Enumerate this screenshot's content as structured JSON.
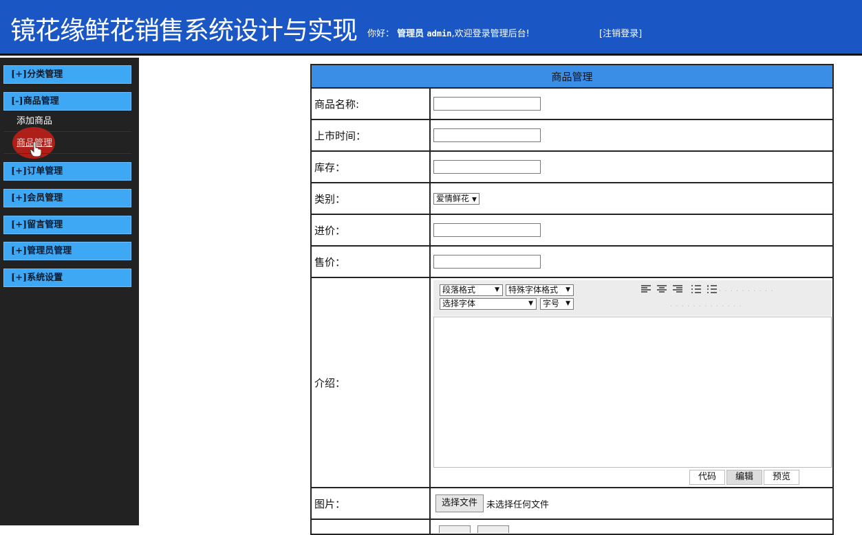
{
  "header": {
    "title": "镜花缘鲜花销售系统设计与实现",
    "greeting": "你好：",
    "role": "管理员",
    "username": "admin",
    "welcome": ",欢迎登录管理后台!",
    "logout": "[注销登录]"
  },
  "sidebar": {
    "menus": [
      {
        "label": "[+]分类管理"
      },
      {
        "label": "[-]商品管理"
      },
      {
        "label": "[+]订单管理"
      },
      {
        "label": "[+]会员管理"
      },
      {
        "label": "[+]留言管理"
      },
      {
        "label": "[+]管理员管理"
      },
      {
        "label": "[+]系统设置"
      }
    ],
    "sub_items": [
      {
        "label": "添加商品"
      },
      {
        "label": "商品管理"
      }
    ]
  },
  "form": {
    "title": "商品管理",
    "name_label": "商品名称:",
    "date_label": "上市时间：",
    "stock_label": "库存：",
    "category_label": "类别：",
    "category_value": "爱情鲜花",
    "cost_label": "进价：",
    "price_label": "售价：",
    "intro_label": "介绍：",
    "image_label": "图片：",
    "file_button": "选择文件",
    "file_status": "未选择任何文件"
  },
  "editor": {
    "paragraph_select": "段落格式",
    "special_select": "特殊字体格式",
    "font_select": "选择字体",
    "size_select": "字号",
    "mode_code": "代码",
    "mode_edit": "编辑",
    "mode_preview": "预览",
    "active_mode": "编辑"
  },
  "colors": {
    "header_bg": "#1a56c4",
    "menu_bg": "#3fa8f5",
    "sidebar_bg": "#222222",
    "table_header_bg": "#3a8ee6"
  }
}
